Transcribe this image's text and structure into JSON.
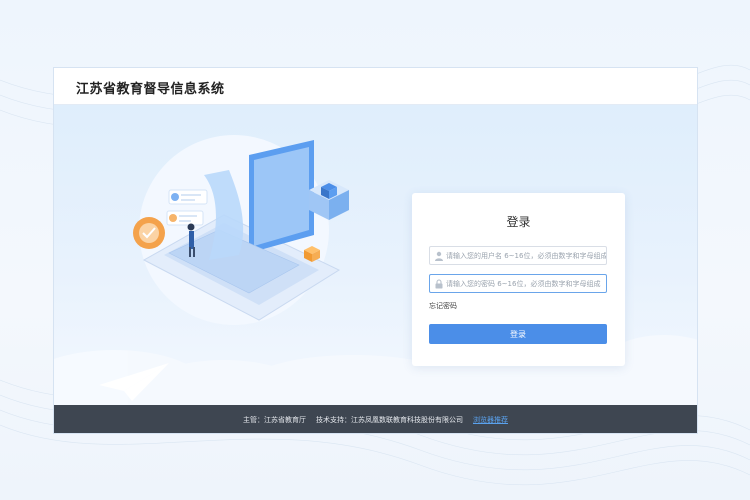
{
  "header": {
    "title": "江苏省教育督导信息系统"
  },
  "login": {
    "title": "登录",
    "username_placeholder": "请输入您的用户名 6~16位，必须由数字和字母组成",
    "password_placeholder": "请输入您的密码 6~16位，必须由数字和字母组成",
    "forgot_label": "忘记密码",
    "submit_label": "登录"
  },
  "footer": {
    "sponsor": "主管：江苏省教育厅",
    "tech_support": "技术支持：江苏凤凰数联教育科技股份有限公司",
    "browser_link": "浏览器推荐"
  },
  "colors": {
    "accent": "#4b8ee8",
    "footer_bg": "#3e4651",
    "link": "#5aa2ee"
  },
  "icons": {
    "username": "user-icon",
    "password": "lock-icon"
  }
}
